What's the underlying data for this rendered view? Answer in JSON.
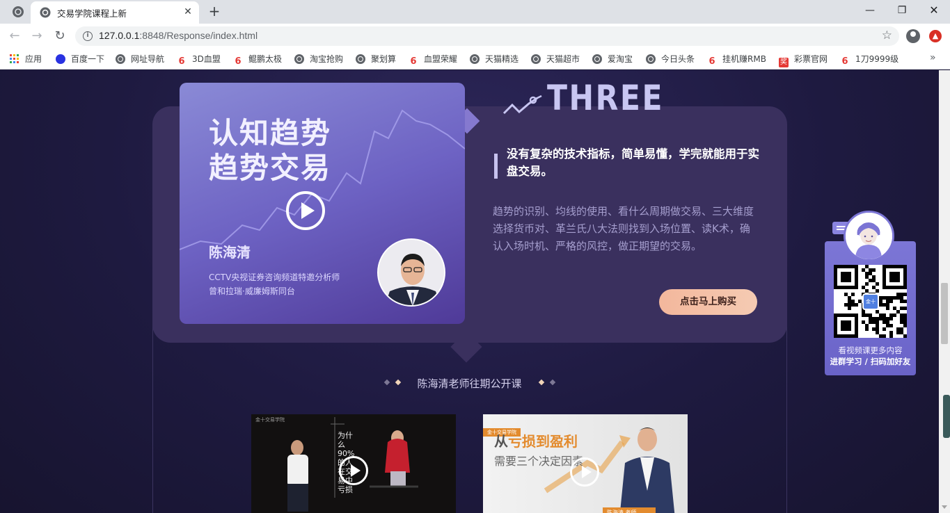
{
  "browser": {
    "tab_title": "交易学院课程上新",
    "url_host": "127.0.0.1",
    "url_rest": ":8848/Response/index.html",
    "bookmarks": [
      {
        "label": "应用",
        "icon": "apps-grid-icon"
      },
      {
        "label": "百度一下",
        "icon": "baidu-paw-icon"
      },
      {
        "label": "网址导航",
        "icon": "globe-icon"
      },
      {
        "label": "3D血盟",
        "icon": "360-icon"
      },
      {
        "label": "鲲鹏太极",
        "icon": "360-icon"
      },
      {
        "label": "淘宝抢购",
        "icon": "globe-icon"
      },
      {
        "label": "聚划算",
        "icon": "globe-icon"
      },
      {
        "label": "血盟荣耀",
        "icon": "360-icon"
      },
      {
        "label": "天猫精选",
        "icon": "globe-icon"
      },
      {
        "label": "天猫超市",
        "icon": "globe-icon"
      },
      {
        "label": "爱淘宝",
        "icon": "globe-icon"
      },
      {
        "label": "今日头条",
        "icon": "globe-icon"
      },
      {
        "label": "挂机赚RMB",
        "icon": "360-icon"
      },
      {
        "label": "彩票官网",
        "icon": "lottery-icon"
      },
      {
        "label": "1刀9999级",
        "icon": "360-icon"
      }
    ]
  },
  "course": {
    "video_title_line1": "认知趋势",
    "video_title_line2": "趋势交易",
    "teacher_name": "陈海清",
    "teacher_sub1": "CCTV央视证券咨询频道特邀分析师",
    "teacher_sub2": "曾和拉瑞·威廉姆斯同台",
    "section_number": "THREE",
    "headline": "没有复杂的技术指标，简单易懂，学完就能用于实盘交易。",
    "description": "趋势的识别、均线的使用、看什么周期做交易、三大维度选择货币对、革兰氏八大法则找到入场位置、读K术，确认入场时机、严格的风控，做正期望的交易。",
    "buy_label": "点击马上购买"
  },
  "past": {
    "title": "陈海清老师往期公开课",
    "thumb1_text": "为什么90%的人在交易中亏损",
    "thumb1_brand": "金十交易学院",
    "thumb2_title_a": "从",
    "thumb2_title_b": "亏损到盈利",
    "thumb2_title_c": "需要三个决定因素",
    "thumb2_brand": "金十交易学院",
    "thumb2_tag": "陈海清 老师"
  },
  "qr": {
    "caption1": "看视频课更多内容",
    "caption2": "进群学习 / 扫码加好友",
    "center_label": "金十"
  },
  "colors": {
    "page_bg": "#1e1a40",
    "panel": "#3a305e",
    "accent_btn": "#f3b79c"
  }
}
